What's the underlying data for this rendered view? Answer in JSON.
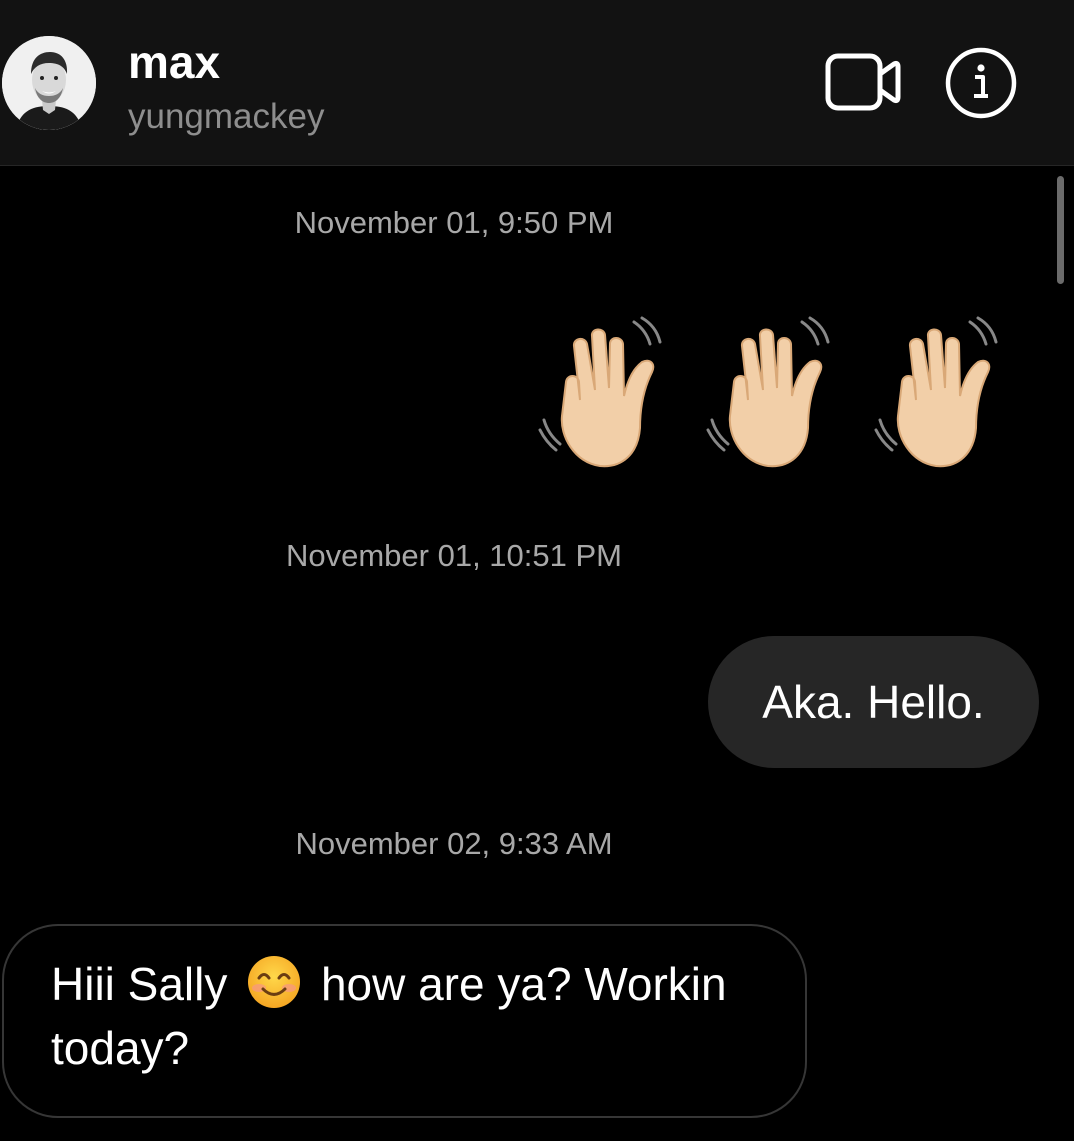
{
  "header": {
    "contact_name": "max",
    "contact_username": "yungmackey",
    "video_call_icon": "video-camera-icon",
    "info_icon": "info-circle-icon"
  },
  "messages": [
    {
      "type": "timestamp",
      "text": "November 01, 9:50 PM"
    },
    {
      "type": "sent-emoji",
      "emoji": "👋👋👋",
      "icon": "waving-hand-icon"
    },
    {
      "type": "timestamp",
      "text": "November 01, 10:51 PM"
    },
    {
      "type": "sent",
      "text": "Aka. Hello."
    },
    {
      "type": "timestamp",
      "text": "November 02, 9:33 AM"
    },
    {
      "type": "received",
      "text_before_emoji": "Hiii Sally",
      "emoji": "😊",
      "text_after_emoji": "how are ya? Workin today?"
    }
  ],
  "colors": {
    "background": "#000000",
    "header_background": "#121212",
    "sent_bubble": "#262626",
    "received_bubble_border": "#363636",
    "timestamp_text": "#a8a8a8",
    "username_text": "#8e8e8e",
    "wave_skin": "#f2cfa8"
  }
}
